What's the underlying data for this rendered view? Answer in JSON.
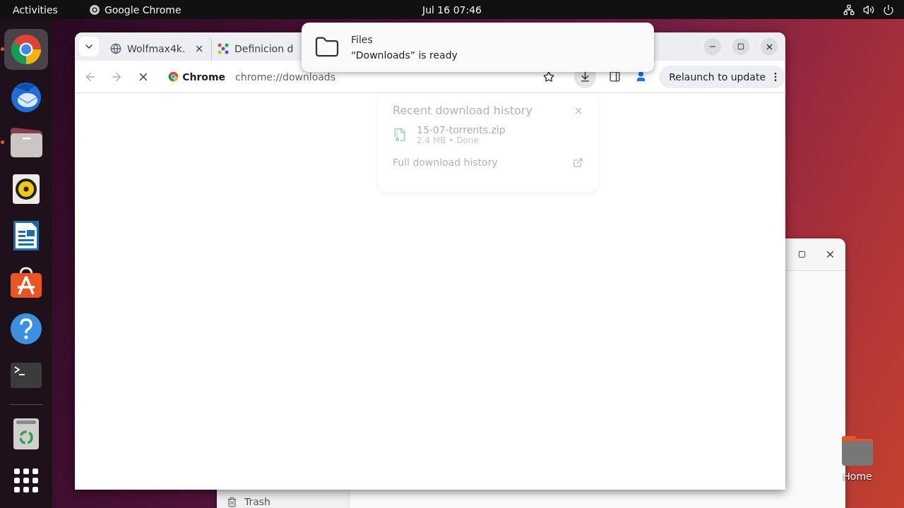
{
  "top_bar": {
    "activities": "Activities",
    "app_name": "Google Chrome",
    "clock": "Jul 16  07:46"
  },
  "dock": {
    "items": [
      {
        "kind": "chrome",
        "running": true,
        "focused": true
      },
      {
        "kind": "mail",
        "running": false,
        "focused": false
      },
      {
        "kind": "files",
        "running": true,
        "focused": false
      },
      {
        "kind": "music",
        "running": false,
        "focused": false
      },
      {
        "kind": "writer",
        "running": false,
        "focused": false
      },
      {
        "kind": "store",
        "running": false,
        "focused": false
      },
      {
        "kind": "help",
        "running": false,
        "focused": false
      },
      {
        "kind": "terminal",
        "running": false,
        "focused": false
      },
      {
        "kind": "trash",
        "running": false,
        "focused": false
      },
      {
        "kind": "apps",
        "running": false,
        "focused": false
      }
    ]
  },
  "files_window": {
    "sidebar": [
      {
        "label": "Trash"
      }
    ]
  },
  "desktop_icons": [
    {
      "label": "Home"
    }
  ],
  "chrome_window": {
    "tabs": [
      {
        "title": "Wolfmax4k.",
        "selected": false
      },
      {
        "title": "Definicion d",
        "selected": false
      }
    ],
    "back": {
      "disabled": true
    },
    "forward": {
      "disabled": true
    },
    "omnibox": {
      "chip": "Chrome",
      "url": "chrome://downloads"
    },
    "relaunch": "Relaunch to update",
    "downloads_bubble": {
      "title": "Recent download history",
      "items": [
        {
          "name": "15-07-torrents.zip",
          "status": "2.4 MB • Done"
        }
      ],
      "footer": "Full download history"
    }
  },
  "notification": {
    "app": "Files",
    "message": "“Downloads” is ready"
  }
}
